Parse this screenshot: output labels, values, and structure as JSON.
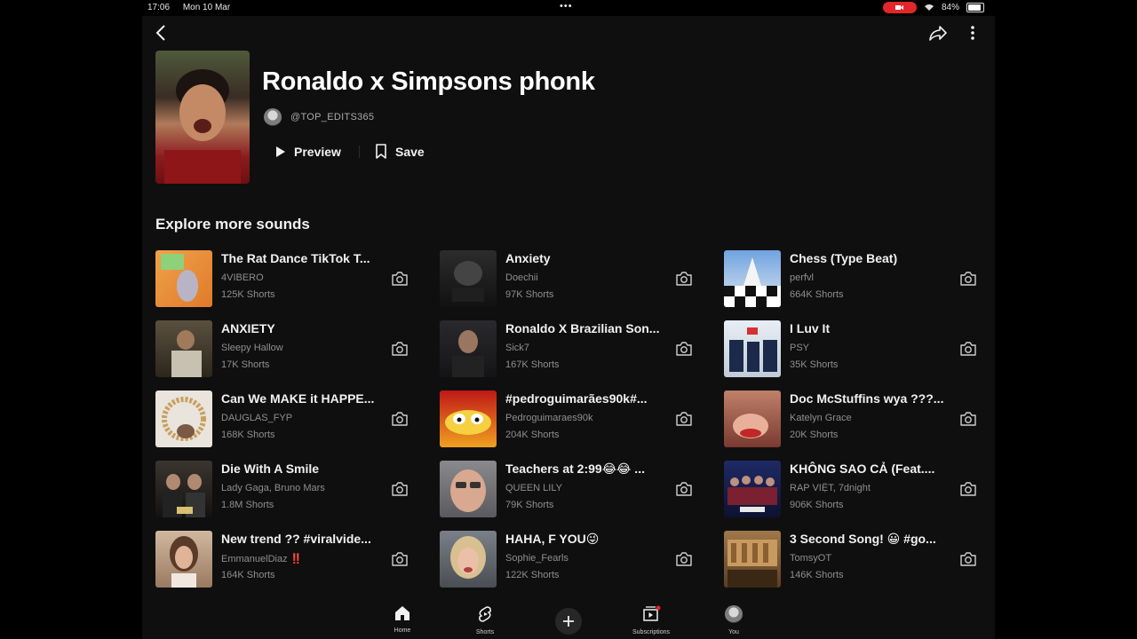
{
  "status": {
    "time": "17:06",
    "date": "Mon 10 Mar",
    "battery": "84%",
    "accent": "#e3262b"
  },
  "header": {
    "back_icon": "chevron-left-icon",
    "share_icon": "share-icon",
    "more_icon": "more-vertical-icon"
  },
  "sound": {
    "title": "Ronaldo x Simpsons phonk",
    "channel": "@TOP_EDITS365",
    "preview_label": "Preview",
    "save_label": "Save"
  },
  "explore": {
    "title": "Explore more sounds",
    "items": [
      {
        "title": "The Rat Dance TikTok T...",
        "artist": "4VIBERO",
        "count": "125K Shorts"
      },
      {
        "title": "Anxiety",
        "artist": "Doechii",
        "count": "97K Shorts"
      },
      {
        "title": "Chess (Type Beat)",
        "artist": "perfvl",
        "count": "664K Shorts"
      },
      {
        "title": "ANXIETY",
        "artist": "Sleepy Hallow",
        "count": "17K Shorts"
      },
      {
        "title": "Ronaldo X Brazilian Son...",
        "artist": "Sick7",
        "count": "167K Shorts"
      },
      {
        "title": "I Luv It",
        "artist": "PSY",
        "count": "35K Shorts"
      },
      {
        "title": "Can We MAKE it HAPPE...",
        "artist": "DAUGLAS_FYP",
        "count": "168K Shorts"
      },
      {
        "title": "#pedroguimarães90k#...",
        "artist": "Pedroguimaraes90k",
        "count": "204K Shorts"
      },
      {
        "title": "Doc McStuffins wya ???...",
        "artist": "Katelyn Grace",
        "count": "20K Shorts"
      },
      {
        "title": "Die With A Smile",
        "artist": "Lady Gaga, Bruno Mars",
        "count": "1.8M Shorts"
      },
      {
        "title": "Teachers at 2:99😂😂 ...",
        "artist": "QUEEN LILY",
        "count": "79K Shorts"
      },
      {
        "title": "KHÔNG SAO CẢ (Feat....",
        "artist": "RAP VIỆT, 7dnight",
        "count": "906K Shorts"
      },
      {
        "title": "New trend ?? #viralvide...",
        "artist": "EmmanuelDiaz ‼️",
        "count": "164K Shorts"
      },
      {
        "title": "HAHA, F YOU😜",
        "artist": "Sophie_Fearls",
        "count": "122K Shorts"
      },
      {
        "title": "3 Second Song! 😀 #go...",
        "artist": "TomsyOT",
        "count": "146K Shorts"
      }
    ]
  },
  "nav": {
    "home": "Home",
    "shorts": "Shorts",
    "subscriptions": "Subscriptions",
    "you": "You"
  }
}
